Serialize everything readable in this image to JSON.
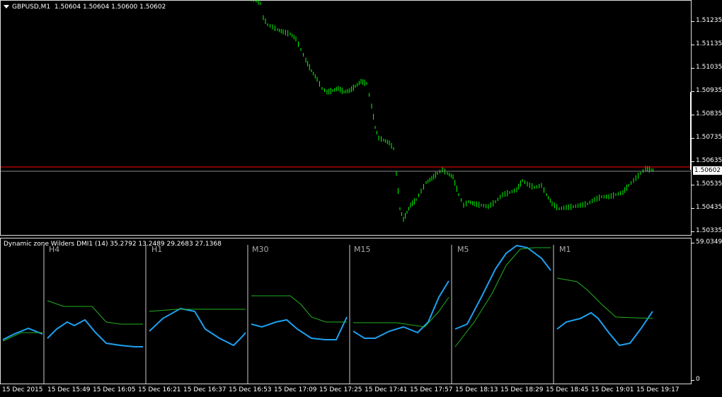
{
  "main": {
    "symbol": "GBPUSD,M1",
    "ohlc": "1.50604 1.50604 1.50600 1.50602",
    "price_ticks": [
      "1.51235",
      "1.51135",
      "1.51035",
      "1.50935",
      "1.50835",
      "1.50735",
      "1.50635",
      "1.50535",
      "1.50435",
      "1.50335"
    ],
    "current_price": "1.50602",
    "colors": {
      "candle": "#00ff00",
      "line": "#ff0000",
      "bg": "#000000"
    }
  },
  "indicator": {
    "title": "Dynamic zone Wilders DMI1 (14) 35.2792 13.2489 29.2683 27.1368",
    "axis_top": "59.0349",
    "axis_bottom": "0",
    "timeframes": [
      "H4",
      "H1",
      "M30",
      "M15",
      "M5",
      "M1"
    ],
    "colors": {
      "plus": "#1ea0f0",
      "minus": "#22b022",
      "sep": "#888888"
    }
  },
  "time_axis": [
    "15 Dec 2015",
    "15 Dec 15:49",
    "15 Dec 16:05",
    "15 Dec 16:21",
    "15 Dec 16:37",
    "15 Dec 16:53",
    "15 Dec 17:09",
    "15 Dec 17:25",
    "15 Dec 17:41",
    "15 Dec 17:57",
    "15 Dec 18:13",
    "15 Dec 18:29",
    "15 Dec 18:45",
    "15 Dec 19:01",
    "15 Dec 19:17"
  ]
}
